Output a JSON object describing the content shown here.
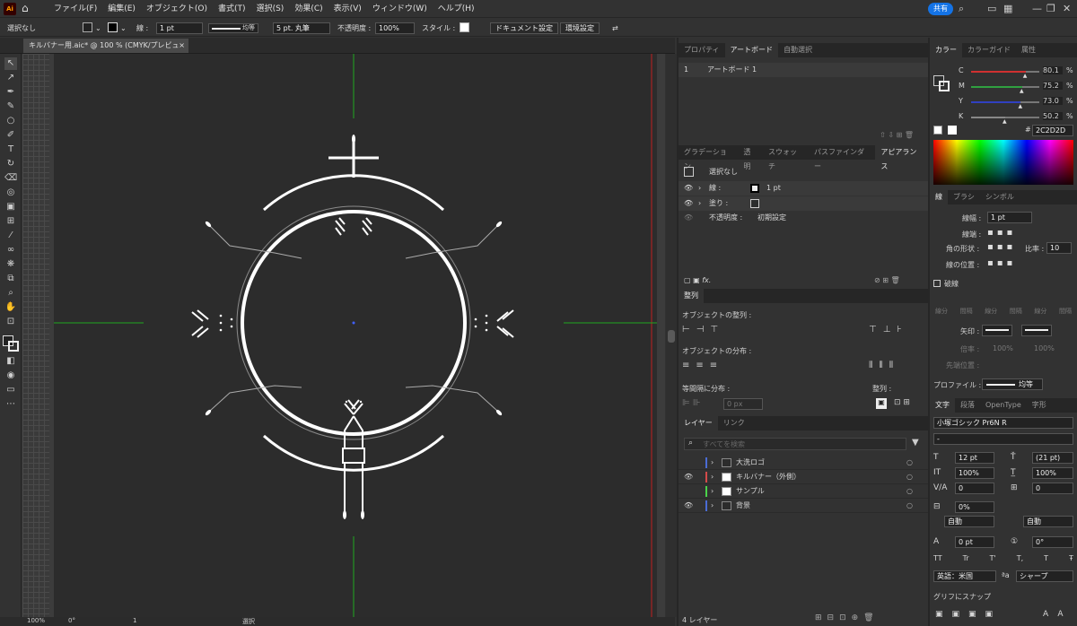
{
  "app": {
    "logo": "Ai",
    "share_label": "共有"
  },
  "menu": [
    "ファイル(F)",
    "編集(E)",
    "オブジェクト(O)",
    "書式(T)",
    "選択(S)",
    "効果(C)",
    "表示(V)",
    "ウィンドウ(W)",
    "ヘルプ(H)"
  ],
  "control_bar": {
    "selection": "選択なし",
    "stroke_label": "線 :",
    "stroke_weight": "1 pt",
    "stroke_profile": "均等",
    "brush": "5 pt. 丸筆",
    "opacity_label": "不透明度 :",
    "opacity": "100%",
    "style_label": "スタイル :",
    "doc_setup_btn": "ドキュメント設定",
    "prefs_btn": "環境設定"
  },
  "document_tab": {
    "title": "キルバナー用.aic* @ 100 % (CMYK/プレビュー)",
    "close": "×"
  },
  "status_bar": {
    "zoom": "100%",
    "rotation": "0°",
    "artboard": "1",
    "mode": "選択"
  },
  "panel_artboards": {
    "tabs": [
      "プロパティ",
      "アートボード",
      "自動選択"
    ],
    "active": 1,
    "row_index": "1",
    "row_name": "アートボード 1"
  },
  "panel_appearance": {
    "tabs": [
      "グラデーション",
      "透明",
      "スウォッチ",
      "パスファインダー",
      "アピアランス"
    ],
    "active": 4,
    "title": "選択なし",
    "stroke_label": "線 :",
    "stroke_value": "1 pt",
    "fill_label": "塗り :",
    "opacity_label": "不透明度 :",
    "opacity_value": "初期設定",
    "fx": "fx."
  },
  "panel_align": {
    "tab": "整列",
    "align_objects": "オブジェクトの整列 :",
    "distribute_objects": "オブジェクトの分布 :",
    "distribute_spacing": "等間隔に分布 :",
    "align_to": "整列 :",
    "spacing_value": "0 px"
  },
  "panel_layers": {
    "tabs": [
      "レイヤー",
      "リンク"
    ],
    "active": 0,
    "search_placeholder": "すべてを検索",
    "layers": [
      {
        "name": "大洗ロゴ",
        "color": "#4a6cd4",
        "visible": false
      },
      {
        "name": "キルバナー（外側）",
        "color": "#d44a4a",
        "visible": true
      },
      {
        "name": "サンプル",
        "color": "#4ad44a",
        "visible": false
      },
      {
        "name": "背景",
        "color": "#4a6cd4",
        "visible": true
      }
    ],
    "footer": "4 レイヤー"
  },
  "panel_color": {
    "tabs": [
      "カラー",
      "カラーガイド",
      "属性"
    ],
    "active": 0,
    "channels": [
      {
        "label": "C",
        "value": "80.1",
        "unit": "%",
        "fill": 0.8,
        "color": "#d03030"
      },
      {
        "label": "M",
        "value": "75.2",
        "unit": "%",
        "fill": 0.75,
        "color": "#30a040"
      },
      {
        "label": "Y",
        "value": "73.0",
        "unit": "%",
        "fill": 0.73,
        "color": "#3040c0"
      },
      {
        "label": "K",
        "value": "50.2",
        "unit": "%",
        "fill": 0.5,
        "color": "#888888"
      }
    ],
    "hex": "2C2D2D"
  },
  "panel_stroke": {
    "tabs": [
      "線",
      "ブラシ",
      "シンボル"
    ],
    "active": 0,
    "weight_label": "線幅 :",
    "weight_value": "1 pt",
    "cap_label": "線端 :",
    "corner_label": "角の形状 :",
    "ratio_label": "比率 :",
    "ratio_value": "10",
    "align_label": "線の位置 :",
    "dashed_label": "破線",
    "dash_cells": [
      "線分",
      "間隔",
      "線分",
      "間隔",
      "線分",
      "間隔"
    ],
    "arrow_label": "矢印 :",
    "scale_label": "倍率 :",
    "scale_values": [
      "100%",
      "100%"
    ],
    "tip_label": "先端位置 :",
    "profile_label": "プロファイル :",
    "profile_value": "均等"
  },
  "panel_character": {
    "tabs": [
      "文字",
      "段落",
      "OpenType",
      "字形"
    ],
    "active": 0,
    "font_family": "小塚ゴシック Pr6N R",
    "font_style": "-",
    "size": "12 pt",
    "leading": "(21 pt)",
    "vscale": "100%",
    "hscale": "100%",
    "kerning": "0",
    "tracking": "0",
    "tsume": "0%",
    "aki_left": "自動",
    "aki_right": "自動",
    "baseline": "0 pt",
    "rotation": "0°",
    "language": "英語：米国",
    "antialias": "シャープ",
    "snap_label": "グリフにスナップ",
    "tt_buttons": [
      "TT",
      "Tr",
      "T'",
      "T,",
      "T",
      "Ŧ"
    ]
  },
  "colors": {
    "accent": "#1473e6",
    "artboard": "#2c2c2c",
    "guide_green": "#1fa81f",
    "bleed_red": "#c02020"
  }
}
